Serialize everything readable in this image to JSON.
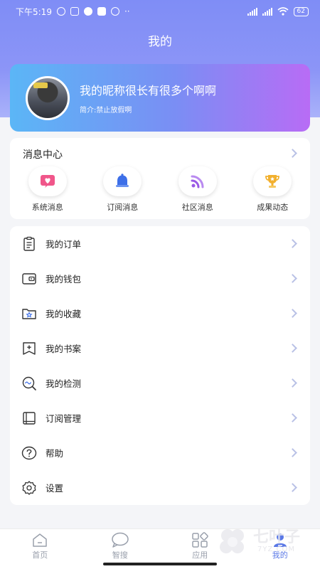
{
  "status_bar": {
    "time": "下午5:19",
    "battery": "62"
  },
  "header": {
    "title": "我的"
  },
  "profile": {
    "nickname": "我的昵称很长有很多个啊啊",
    "bio": "简介:禁止放假啊"
  },
  "messages": {
    "title": "消息中心",
    "items": [
      {
        "label": "系统消息",
        "icon": "message-heart-icon",
        "color": "#f0568a"
      },
      {
        "label": "订阅消息",
        "icon": "bell-icon",
        "color": "#3d6fe8"
      },
      {
        "label": "社区消息",
        "icon": "wifi-signal-icon",
        "color": "#9a5ae6"
      },
      {
        "label": "成果动态",
        "icon": "trophy-icon",
        "color": "#f2b02e"
      }
    ]
  },
  "menu": {
    "items": [
      {
        "label": "我的订单",
        "icon": "clipboard-icon"
      },
      {
        "label": "我的钱包",
        "icon": "wallet-icon"
      },
      {
        "label": "我的收藏",
        "icon": "folder-star-icon"
      },
      {
        "label": "我的书案",
        "icon": "bookmark-plus-icon"
      },
      {
        "label": "我的检测",
        "icon": "magnifier-wave-icon"
      },
      {
        "label": "订阅管理",
        "icon": "book-icon"
      },
      {
        "label": "帮助",
        "icon": "question-icon"
      },
      {
        "label": "设置",
        "icon": "settings-icon"
      }
    ]
  },
  "tabbar": {
    "items": [
      {
        "label": "首页",
        "icon": "home-icon",
        "active": false
      },
      {
        "label": "智搜",
        "icon": "search-bubble-icon",
        "active": false
      },
      {
        "label": "应用",
        "icon": "apps-grid-icon",
        "active": false
      },
      {
        "label": "我的",
        "icon": "user-icon",
        "active": true
      }
    ],
    "active_color": "#5a78e6",
    "inactive_color": "#9aa0ac"
  },
  "watermark": {
    "text": "七叶子",
    "sub": "7YZ.COM"
  }
}
